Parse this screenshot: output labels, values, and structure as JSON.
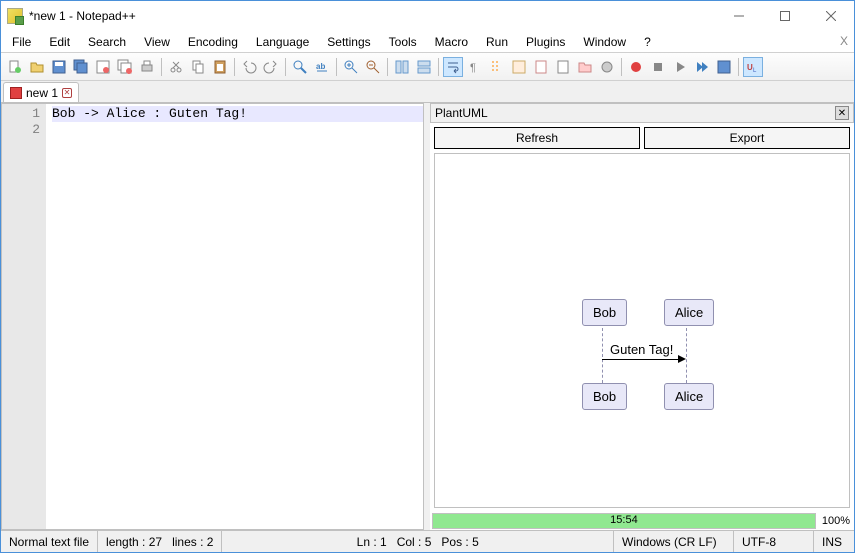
{
  "titlebar": {
    "text": "*new 1 - Notepad++"
  },
  "menubar": {
    "items": [
      "File",
      "Edit",
      "Search",
      "View",
      "Encoding",
      "Language",
      "Settings",
      "Tools",
      "Macro",
      "Run",
      "Plugins",
      "Window",
      "?"
    ]
  },
  "tab": {
    "label": "new 1"
  },
  "editor": {
    "line_numbers": [
      "1",
      "2"
    ],
    "line1": "Bob -> Alice : Guten Tag!",
    "line2": ""
  },
  "plugin": {
    "title": "PlantUML",
    "refresh": "Refresh",
    "export": "Export",
    "diagram": {
      "actor1": "Bob",
      "actor2": "Alice",
      "message": "Guten Tag!"
    },
    "time": "15:54",
    "percent": "100%"
  },
  "statusbar": {
    "filetype": "Normal text file",
    "length": "length : 27",
    "lines": "lines : 2",
    "ln": "Ln : 1",
    "col": "Col : 5",
    "pos": "Pos : 5",
    "eol": "Windows (CR LF)",
    "encoding": "UTF-8",
    "ins": "INS"
  }
}
